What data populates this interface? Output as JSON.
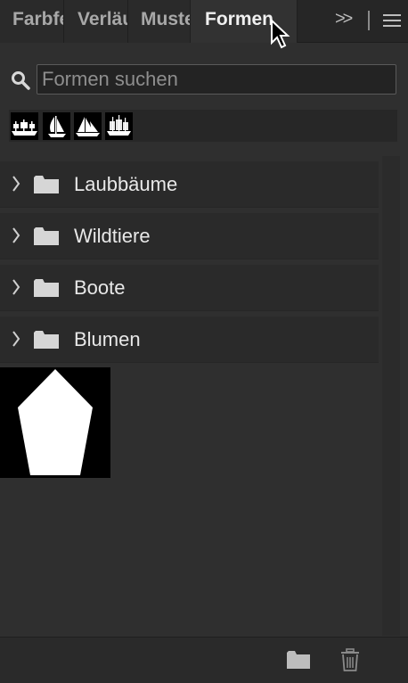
{
  "tabs": [
    {
      "label": "Farbfelder"
    },
    {
      "label": "Verläufe"
    },
    {
      "label": "Muster"
    },
    {
      "label": "Formen"
    }
  ],
  "active_tab": "Formen",
  "search": {
    "placeholder": "Formen suchen",
    "value": ""
  },
  "recent_shapes": [
    {
      "icon": "ship-icon"
    },
    {
      "icon": "sailboat-icon"
    },
    {
      "icon": "sailing-ship-icon"
    },
    {
      "icon": "schooner-icon"
    }
  ],
  "groups": [
    {
      "label": "Laubbäume"
    },
    {
      "label": "Wildtiere"
    },
    {
      "label": "Boote"
    },
    {
      "label": "Blumen"
    }
  ],
  "shape_preview": {
    "icon": "pentagon-shape-icon"
  },
  "bottom_bar": {
    "new_group_icon": "folder-icon",
    "delete_icon": "trash-icon"
  },
  "colors": {
    "panel_bg": "#2f2f2f",
    "row_bg": "#2a2a2a",
    "text": "#e8e8e8",
    "thumb_bg": "#000000"
  }
}
